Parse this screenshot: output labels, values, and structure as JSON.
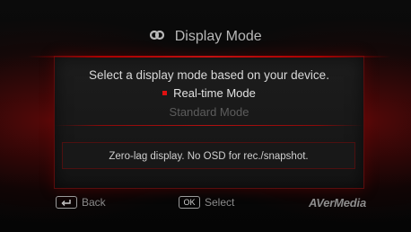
{
  "header": {
    "icon": "link-rings-icon",
    "title": "Display Mode"
  },
  "panel": {
    "instruction": "Select a display mode based on your device.",
    "options": [
      {
        "label": "Real-time Mode",
        "selected": true
      },
      {
        "label": "Standard Mode",
        "selected": false
      }
    ],
    "description": "Zero-lag display. No OSD for rec./snapshot."
  },
  "footer": {
    "back_label": "Back",
    "back_icon": "return-arrow-icon",
    "select_key": "OK",
    "select_label": "Select",
    "brand": "AVerMedia"
  },
  "colors": {
    "accent": "#e01010",
    "glow": "#960808",
    "text": "#d9d9d9",
    "dim_text": "#5c5c5c"
  }
}
